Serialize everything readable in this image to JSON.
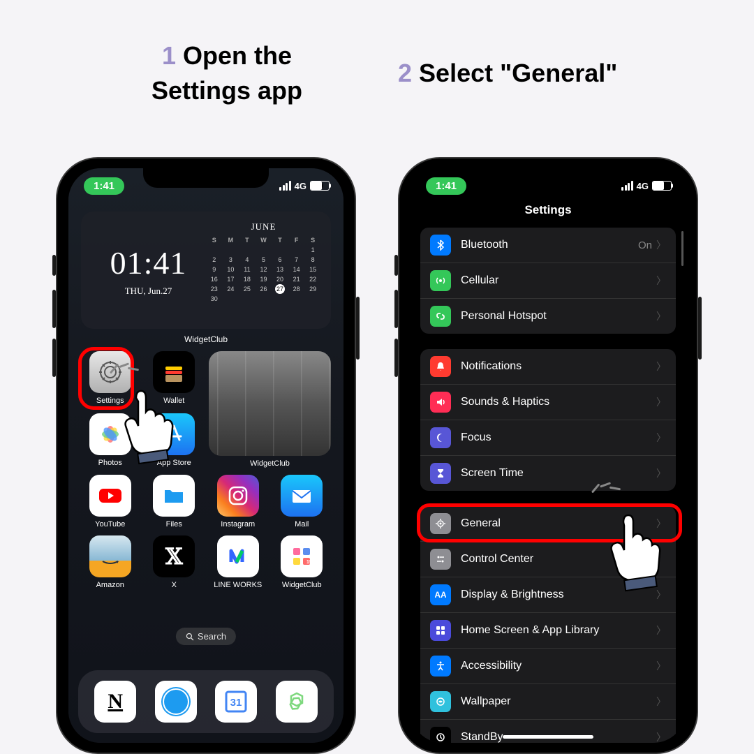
{
  "instruction1": {
    "num": "1",
    "text_line1": "Open the",
    "text_line2": "Settings app"
  },
  "instruction2": {
    "num": "2",
    "text": "Select \"General\""
  },
  "status": {
    "time": "1:41",
    "network": "4G",
    "battery1": "59",
    "battery2": "60"
  },
  "widget": {
    "time": "01:41",
    "date": "THU, Jun.27",
    "month": "JUNE",
    "label": "WidgetClub",
    "days_header": [
      "S",
      "M",
      "T",
      "W",
      "T",
      "F",
      "S"
    ]
  },
  "photo_widget_label": "WidgetClub",
  "search": {
    "label": "Search"
  },
  "apps": {
    "settings": "Settings",
    "wallet": "Wallet",
    "photos": "Photos",
    "appstore": "App Store",
    "youtube": "YouTube",
    "files": "Files",
    "instagram": "Instagram",
    "mail": "Mail",
    "amazon": "Amazon",
    "x": "X",
    "lineworks": "LINE WORKS",
    "widgetclub": "WidgetClub"
  },
  "settings_screen": {
    "title": "Settings",
    "groups": [
      [
        {
          "icon_bg": "#007aff",
          "glyph": "bt",
          "label": "Bluetooth",
          "value": "On"
        },
        {
          "icon_bg": "#34c759",
          "glyph": "ant",
          "label": "Cellular"
        },
        {
          "icon_bg": "#34c759",
          "glyph": "link",
          "label": "Personal Hotspot"
        }
      ],
      [
        {
          "icon_bg": "#ff3b30",
          "glyph": "bell",
          "label": "Notifications"
        },
        {
          "icon_bg": "#ff2d55",
          "glyph": "sound",
          "label": "Sounds & Haptics"
        },
        {
          "icon_bg": "#5856d6",
          "glyph": "moon",
          "label": "Focus"
        },
        {
          "icon_bg": "#5856d6",
          "glyph": "hour",
          "label": "Screen Time"
        }
      ],
      [
        {
          "icon_bg": "#8e8e93",
          "glyph": "gear",
          "label": "General"
        },
        {
          "icon_bg": "#8e8e93",
          "glyph": "cc",
          "label": "Control Center"
        },
        {
          "icon_bg": "#007aff",
          "glyph": "sun",
          "label": "Display & Brightness"
        },
        {
          "icon_bg": "#4b4bdb",
          "glyph": "grid",
          "label": "Home Screen & App Library"
        },
        {
          "icon_bg": "#007aff",
          "glyph": "acc",
          "label": "Accessibility"
        },
        {
          "icon_bg": "#30c1dd",
          "glyph": "wp",
          "label": "Wallpaper"
        },
        {
          "icon_bg": "#000000",
          "glyph": "sb",
          "label": "StandBy"
        }
      ]
    ]
  }
}
